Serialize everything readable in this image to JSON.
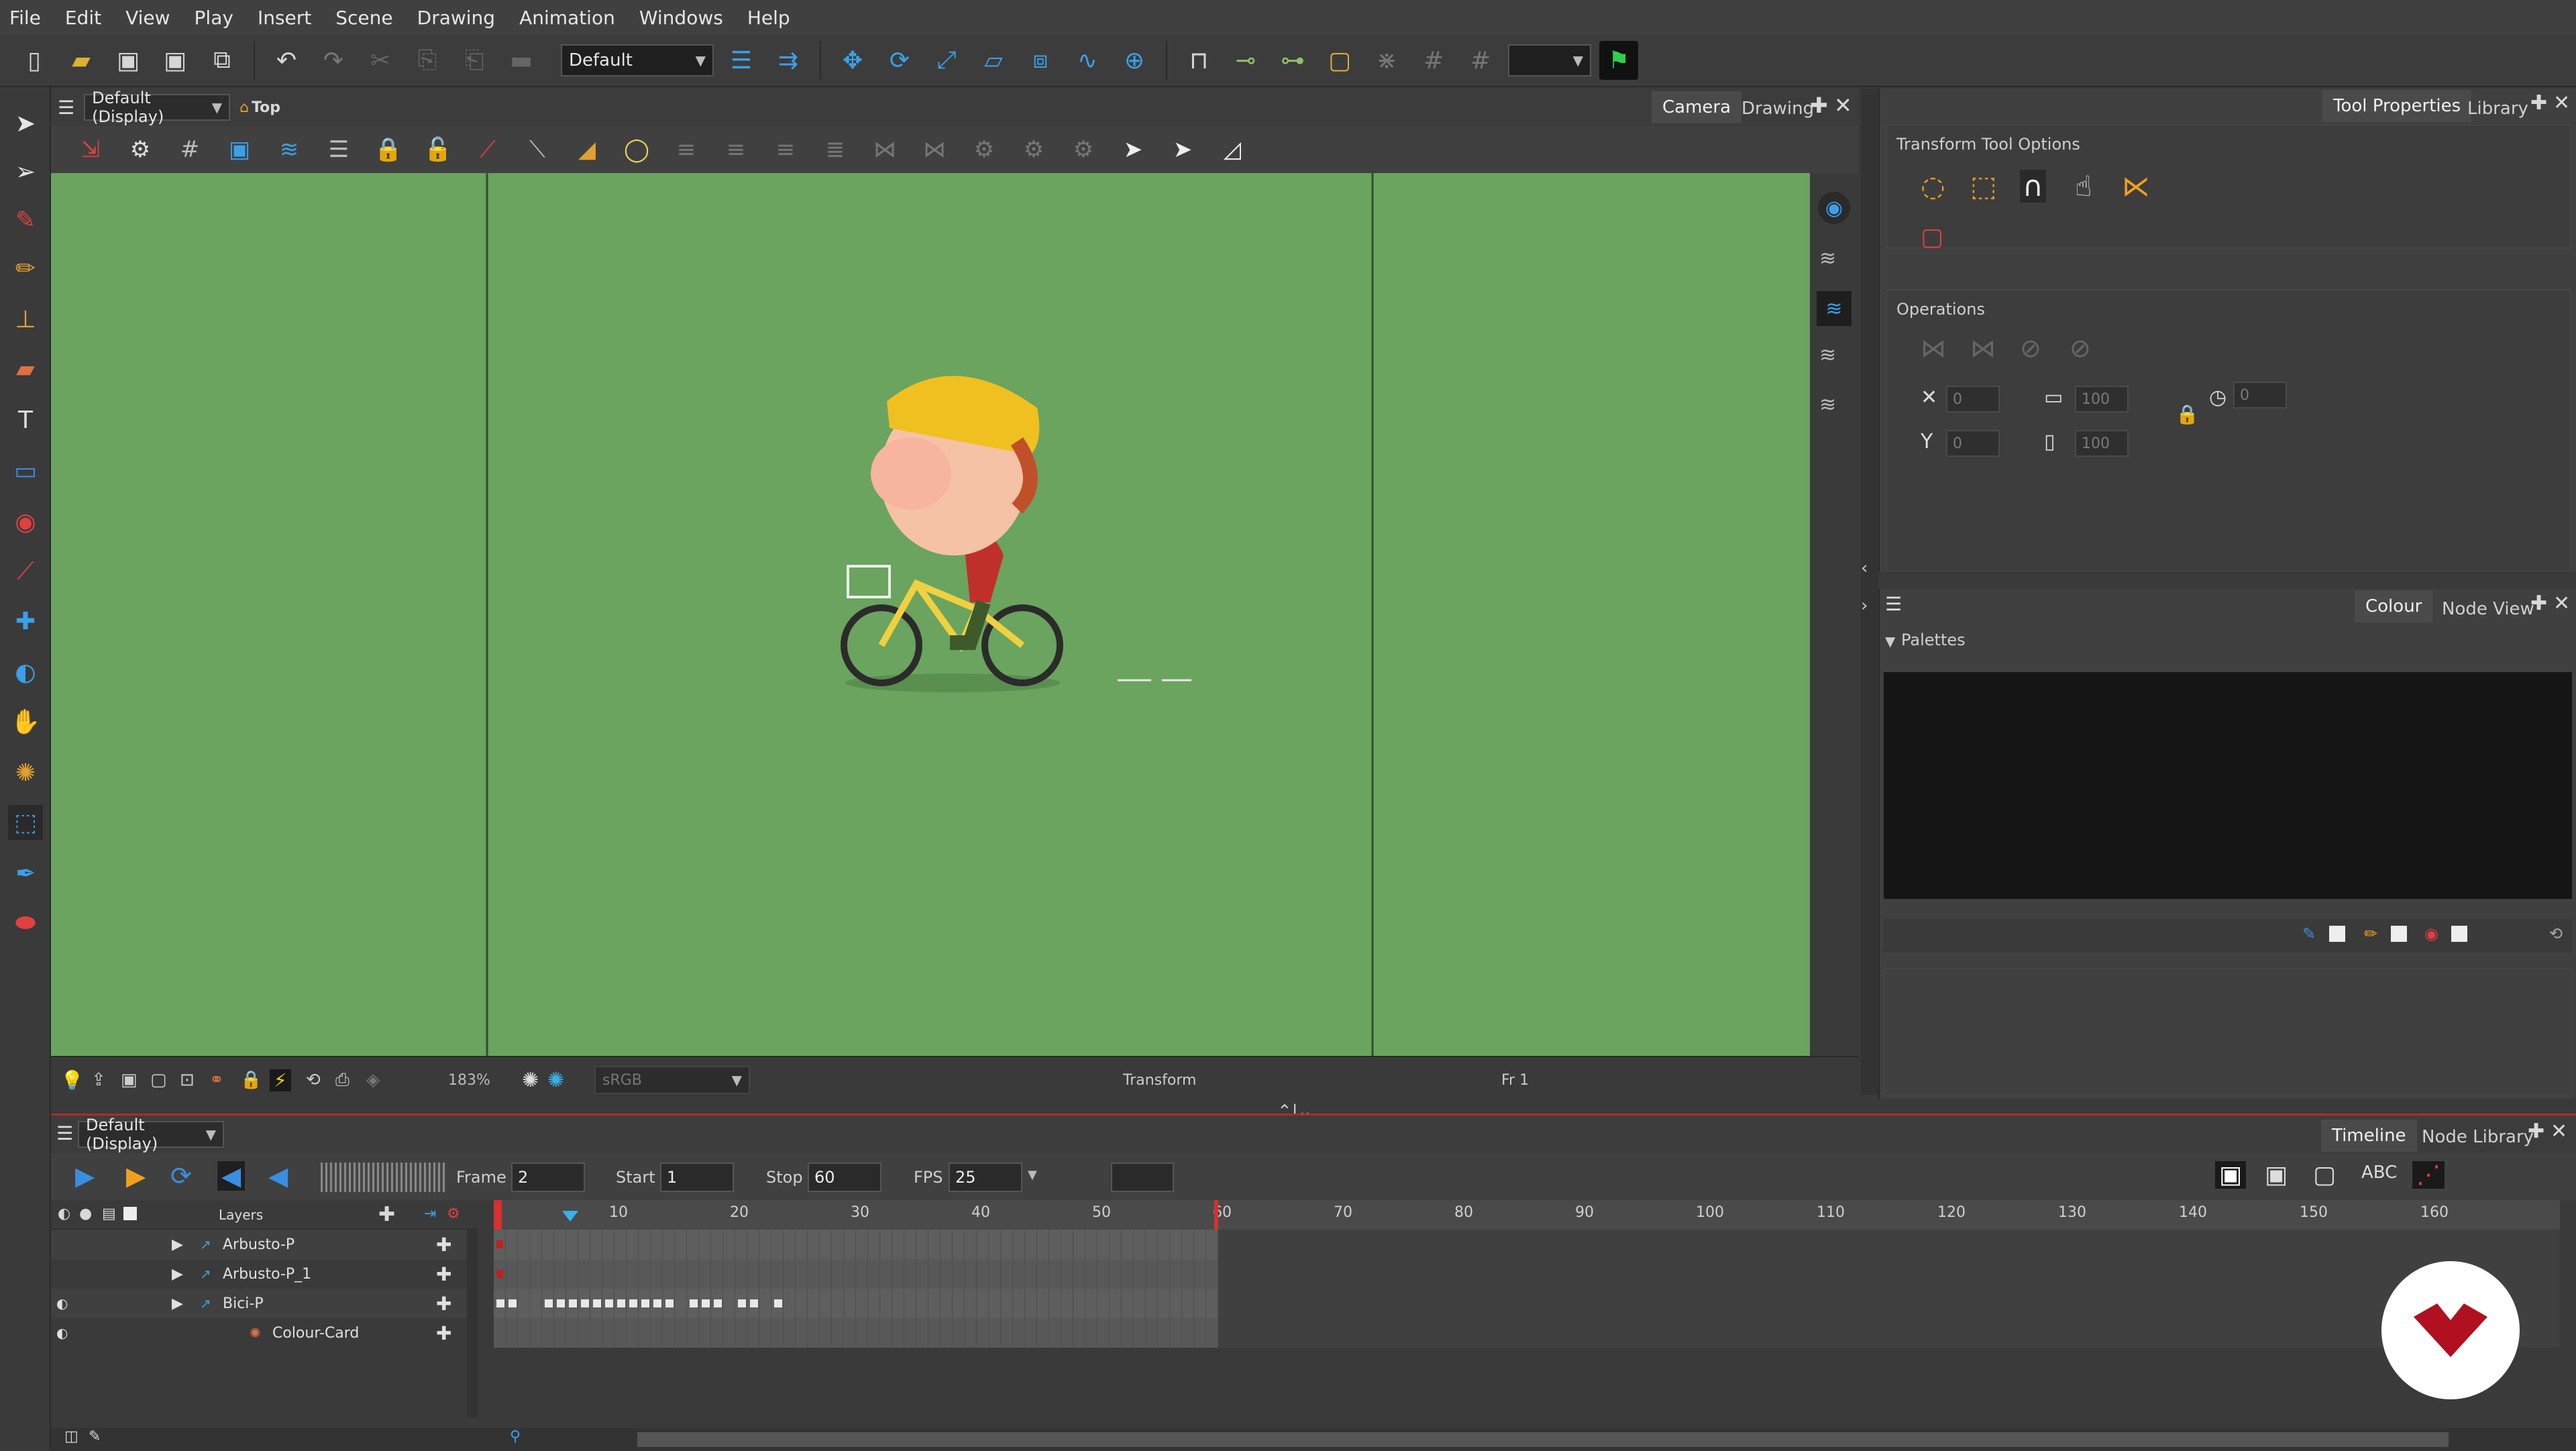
{
  "menubar": [
    "File",
    "Edit",
    "View",
    "Play",
    "Insert",
    "Scene",
    "Drawing",
    "Animation",
    "Windows",
    "Help"
  ],
  "toolbar": {
    "workspace": "Default"
  },
  "camera_view": {
    "view_menu": "Default (Display)",
    "view_mode": "Top",
    "tabs": [
      "Camera",
      "Drawing"
    ],
    "zoom": "183%",
    "colour_space": "sRGB",
    "status_tool": "Transform",
    "status_frame": "Fr 1",
    "colors": {
      "stage": "#6aa45f",
      "frame_line": "#2f4f2a"
    }
  },
  "tool_properties": {
    "tabs": [
      "Tool Properties",
      "Library"
    ],
    "section_title": "Transform Tool Options",
    "operations_title": "Operations",
    "x_value": "0",
    "y_value": "0",
    "width_value": "100",
    "height_value": "100",
    "angle_value": "0"
  },
  "colour_panel": {
    "tabs": [
      "Colour",
      "Node View"
    ],
    "palettes_label": "Palettes"
  },
  "timeline": {
    "view_menu": "Default (Display)",
    "tabs": [
      "Timeline",
      "Node Library"
    ],
    "frame_label": "Frame",
    "frame_value": "2",
    "start_label": "Start",
    "start_value": "1",
    "stop_label": "Stop",
    "stop_value": "60",
    "fps_label": "FPS",
    "fps_value": "25",
    "layers_label": "Layers",
    "layers": [
      {
        "name": "Arbusto-P",
        "type": "peg"
      },
      {
        "name": "Arbusto-P_1",
        "type": "peg"
      },
      {
        "name": "Bici-P",
        "type": "peg"
      },
      {
        "name": "Colour-Card",
        "type": "colour-card"
      }
    ],
    "ruler_ticks": [
      "10",
      "20",
      "30",
      "40",
      "50",
      "60",
      "70",
      "80",
      "90",
      "100",
      "110",
      "120",
      "130",
      "140",
      "150",
      "160"
    ],
    "scene_end_frame": 60,
    "current_frame": 1,
    "colors": {
      "accent": "#b02a2a",
      "playhead": "#d63030",
      "marker": "#3ab0e8"
    }
  }
}
